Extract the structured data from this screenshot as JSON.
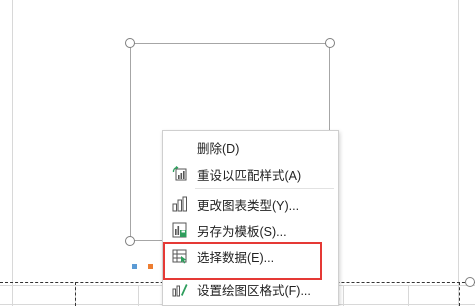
{
  "colors": {
    "highlight": "#e53935",
    "icon_green": "#2e9d5c",
    "icon_gray": "#555555",
    "legend_blue": "#5b9bd5",
    "legend_orange": "#ed7d31"
  },
  "context_menu": {
    "items": [
      {
        "label": "删除(D)",
        "icon": "none"
      },
      {
        "label": "重设以匹配样式(A)",
        "icon": "reset-style-icon"
      },
      {
        "label": "更改图表类型(Y)...",
        "icon": "chart-type-icon"
      },
      {
        "label": "另存为模板(S)...",
        "icon": "save-template-icon"
      },
      {
        "label": "选择数据(E)...",
        "icon": "select-data-icon"
      },
      {
        "label": "设置绘图区格式(F)...",
        "icon": "format-plot-area-icon"
      }
    ]
  }
}
